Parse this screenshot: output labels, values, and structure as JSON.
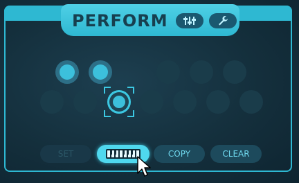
{
  "header": {
    "title": "PERFORM",
    "mixer_icon": "mixer-sliders-icon",
    "wrench_icon": "wrench-icon"
  },
  "pads": {
    "row1": [
      "active",
      "active",
      "dim",
      "dim",
      "dim",
      "dim"
    ],
    "row2": [
      "dim",
      "dim",
      "selected",
      "dim",
      "dim",
      "dim",
      "dim",
      "dim"
    ]
  },
  "buttons": {
    "set_label": "SET",
    "keyboard_icon": "keyboard-icon",
    "copy_label": "COPY",
    "clear_label": "CLEAR"
  },
  "colors": {
    "accent": "#2eb8d2",
    "bright": "#4fd8ee",
    "text_accent": "#6fd8ee",
    "background": "#142f3c"
  }
}
